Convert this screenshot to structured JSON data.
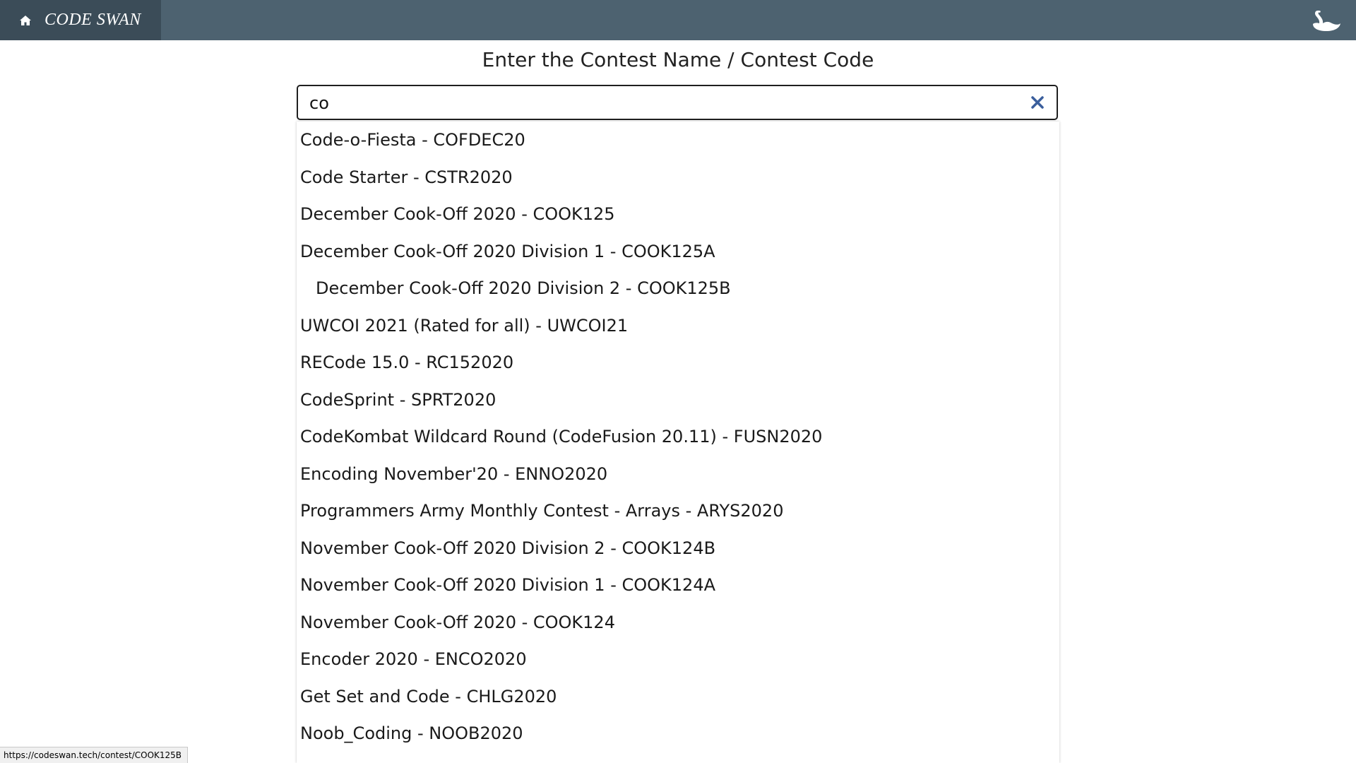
{
  "navbar": {
    "brand_label": "CODE SWAN",
    "home_icon": "home-icon",
    "swan_icon": "swan-icon",
    "background": "#4d6270",
    "brand_background": "#3b4c58"
  },
  "main": {
    "title": "Enter the Contest Name / Contest Code"
  },
  "search": {
    "value": "co",
    "clear_icon": "close-icon"
  },
  "dropdown": {
    "items": [
      {
        "label": "Code-o-Fiesta - COFDEC20"
      },
      {
        "label": "Code Starter - CSTR2020"
      },
      {
        "label": "December Cook-Off 2020 - COOK125"
      },
      {
        "label": "December Cook-Off 2020 Division 1 - COOK125A"
      },
      {
        "label": "December Cook-Off 2020 Division 2 - COOK125B"
      },
      {
        "label": "UWCOI 2021 (Rated for all) - UWCOI21"
      },
      {
        "label": "RECode 15.0 - RC152020"
      },
      {
        "label": "CodeSprint - SPRT2020"
      },
      {
        "label": "CodeKombat Wildcard Round (CodeFusion 20.11) - FUSN2020"
      },
      {
        "label": "Encoding November'20 - ENNO2020"
      },
      {
        "label": "Programmers Army Monthly Contest - Arrays - ARYS2020"
      },
      {
        "label": "November Cook-Off 2020 Division 2 - COOK124B"
      },
      {
        "label": "November Cook-Off 2020 Division 1 - COOK124A"
      },
      {
        "label": "November Cook-Off 2020 - COOK124"
      },
      {
        "label": "Encoder 2020 - ENCO2020"
      },
      {
        "label": "Get Set and Code - CHLG2020"
      },
      {
        "label": "Noob_Coding - NOOB2020"
      }
    ],
    "hovered_index": 4
  },
  "status_bar": {
    "url": "https://codeswan.tech/contest/COOK125B"
  }
}
